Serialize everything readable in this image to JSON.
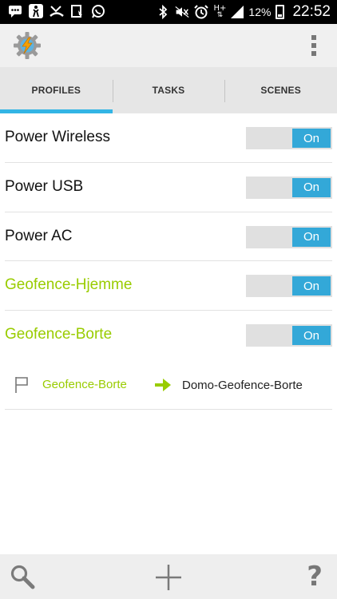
{
  "status_bar": {
    "battery_percent": "12%",
    "time": "22:52",
    "network": "H+",
    "icons": [
      "message-icon",
      "accessibility-icon",
      "missed-call-icon",
      "download-icon",
      "whatsapp-icon",
      "bluetooth-icon",
      "mute-icon",
      "alarm-icon",
      "network-icon",
      "signal-icon",
      "battery-icon"
    ]
  },
  "action_bar": {
    "logo_icon": "tasker-gear-lightning-icon",
    "overflow_icon": "overflow-menu-icon"
  },
  "tabs": [
    {
      "label": "PROFILES",
      "active": true
    },
    {
      "label": "TASKS",
      "active": false
    },
    {
      "label": "SCENES",
      "active": false
    }
  ],
  "profiles": [
    {
      "name": "Power Wireless",
      "state": "On"
    },
    {
      "name": "Power USB",
      "state": "On"
    },
    {
      "name": "Power AC",
      "state": "On"
    },
    {
      "name": "Geofence-Hjemme",
      "state": "On"
    },
    {
      "name": "Geofence-Borte",
      "state": "On"
    }
  ],
  "expanded": {
    "context_icon": "flag-icon",
    "context": "Geofence-Borte",
    "arrow_icon": "arrow-right-icon",
    "task": "Domo-Geofence-Borte"
  },
  "bottom_bar": {
    "icons": [
      "search-icon",
      "add-icon",
      "help-icon"
    ],
    "help_glyph": "?"
  },
  "colors": {
    "accent": "#33b5e5",
    "toggle_on": "#33a8d8",
    "geofence_text": "#99cc00",
    "arrow": "#99cc00"
  }
}
